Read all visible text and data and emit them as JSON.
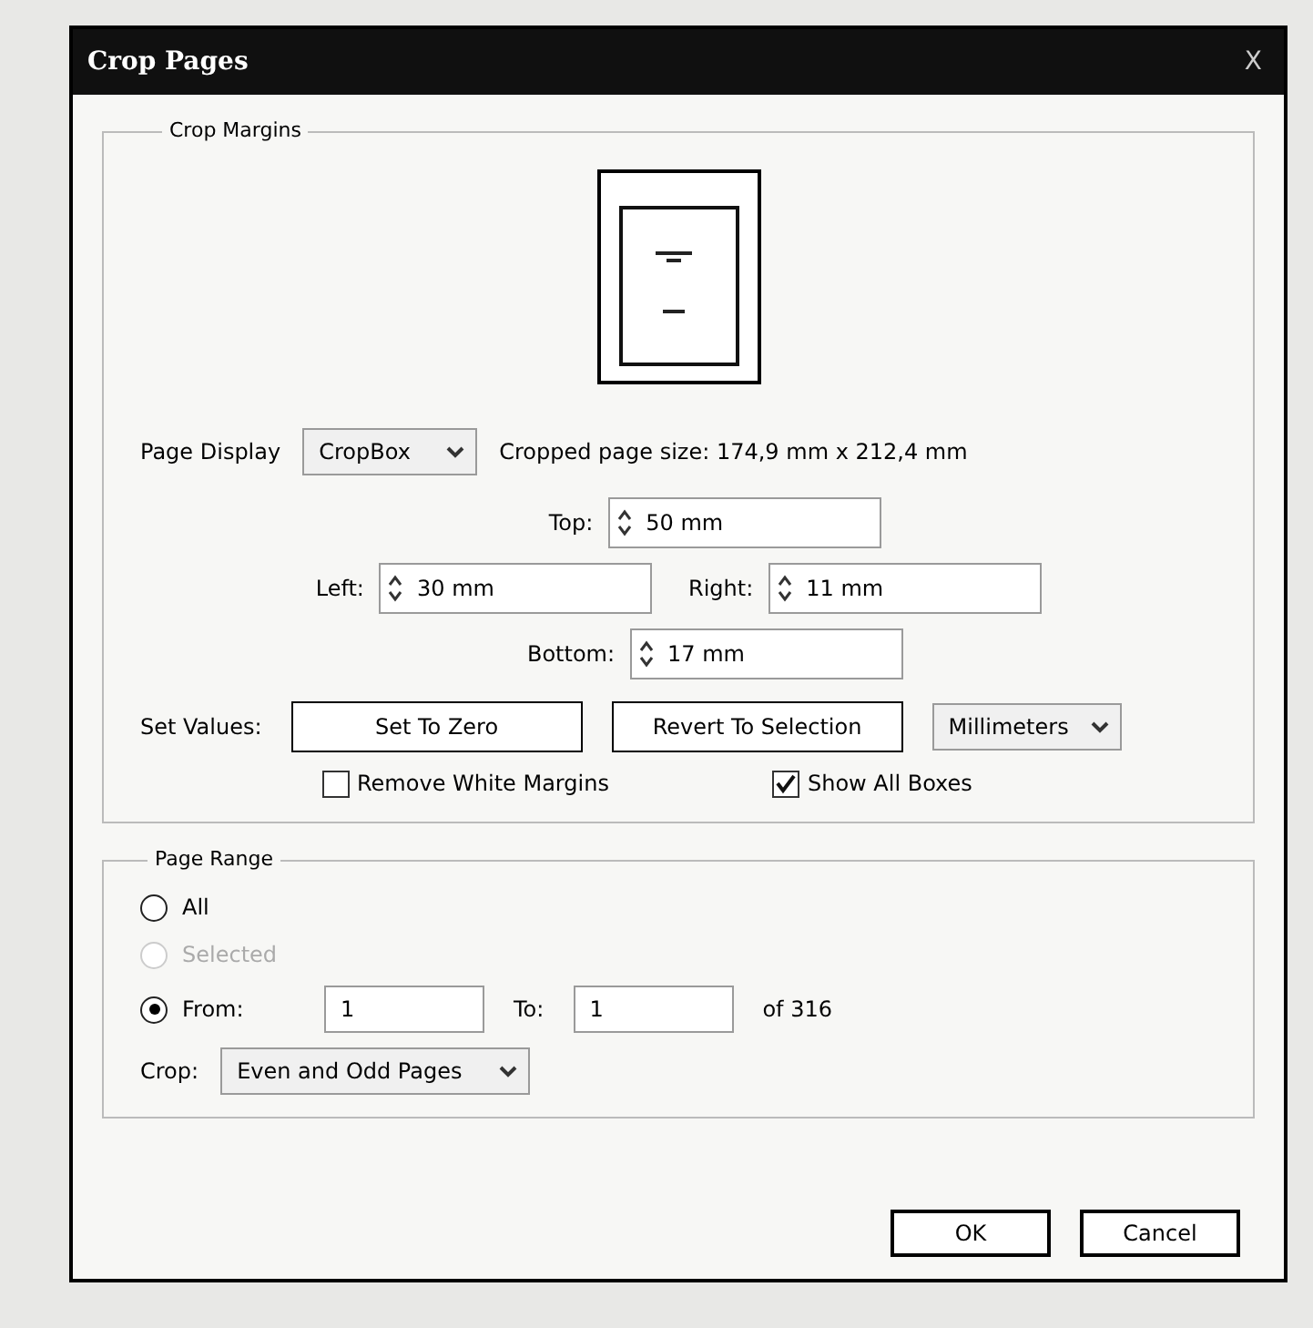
{
  "window": {
    "title": "Crop Pages",
    "close": "X"
  },
  "crop_margins": {
    "legend": "Crop Margins",
    "page_display": {
      "label": "Page Display",
      "value": "CropBox"
    },
    "cropped_size": "Cropped page size: 174,9 mm x 212,4 mm",
    "fields": [
      {
        "kind": "top",
        "label": "Top:",
        "value": "50 mm"
      },
      {
        "kind": "left",
        "label": "Left:",
        "value": "30 mm"
      },
      {
        "kind": "right",
        "label": "Right:",
        "value": "11 mm"
      },
      {
        "kind": "bottom",
        "label": "Bottom:",
        "value": "17 mm"
      }
    ],
    "set_values": {
      "label": "Set Values:",
      "buttons": [
        "Set To Zero",
        "Revert To Selection"
      ],
      "units": "Millimeters"
    },
    "checkboxes": [
      {
        "label": "Remove White Margins",
        "checked": false
      },
      {
        "label": "Show All Boxes",
        "checked": true
      }
    ]
  },
  "page_range": {
    "legend": "Page Range",
    "radios": [
      {
        "label": "All",
        "selected": false,
        "disabled": false
      },
      {
        "label": "Selected",
        "selected": false,
        "disabled": true
      },
      {
        "label": "From:",
        "selected": true,
        "disabled": false
      }
    ],
    "from": "1",
    "to_label": "To:",
    "to": "1",
    "of": "of 316",
    "crop_label": "Crop:",
    "crop_value": "Even and Odd Pages"
  },
  "buttons": [
    "OK",
    "Cancel"
  ]
}
